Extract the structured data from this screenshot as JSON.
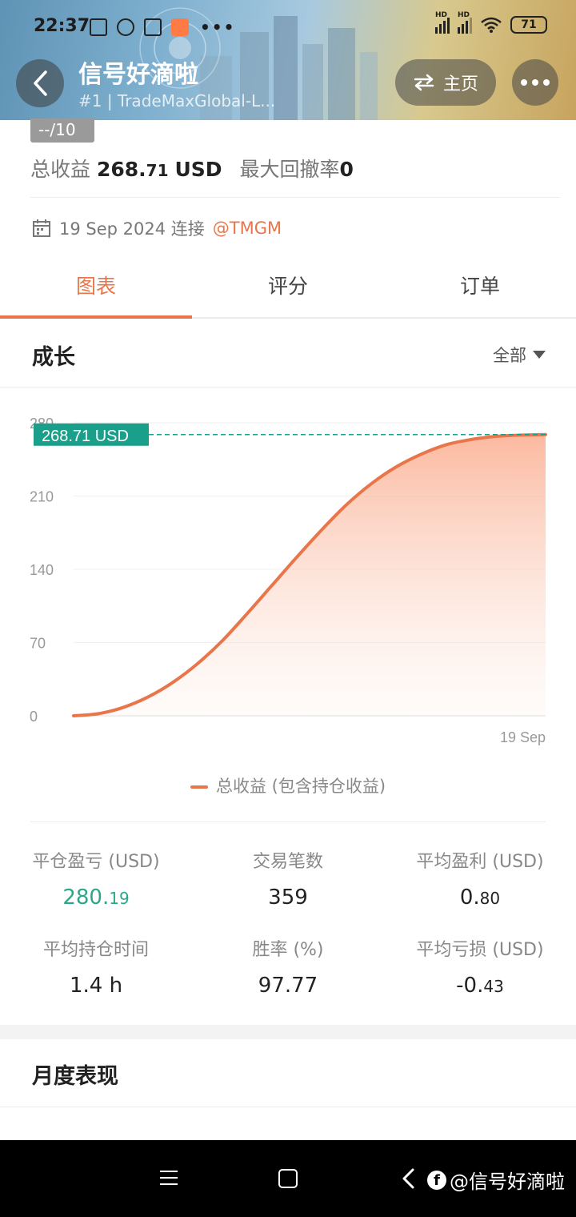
{
  "status_bar": {
    "time": "22:37",
    "battery": "71",
    "hd_label": "HD"
  },
  "header": {
    "title": "信号好滴啦",
    "subtitle": "#1 | TradeMaxGlobal-L...",
    "home_label": "主页"
  },
  "summary": {
    "score": "--/10",
    "total_profit_label": "总收益",
    "total_profit_int": "268.",
    "total_profit_frac": "71",
    "total_profit_unit": "USD",
    "max_drawdown_label": "最大回撤率",
    "max_drawdown_value": "0",
    "connected_date": "19 Sep 2024 连接",
    "broker": "@TMGM"
  },
  "tabs": [
    {
      "label": "图表",
      "active": true
    },
    {
      "label": "评分",
      "active": false
    },
    {
      "label": "订单",
      "active": false
    }
  ],
  "growth": {
    "title": "成长",
    "filter": "全部"
  },
  "chart_data": {
    "type": "area",
    "title": "",
    "ylim": [
      0,
      280
    ],
    "yticks": [
      0,
      70,
      140,
      210,
      280
    ],
    "x_label_end": "19 Sep",
    "current_label": "268.71 USD",
    "current_value": 268.71,
    "series": [
      {
        "name": "总收益 (包含持仓收益)",
        "values": [
          0,
          2,
          8,
          18,
          32,
          50,
          72,
          98,
          125,
          152,
          178,
          202,
          222,
          238,
          250,
          259,
          264,
          267,
          268.2,
          268.71
        ]
      }
    ],
    "colors": {
      "line": "#e8764a",
      "fill": "#fbb59a",
      "marker": "#1a9f8a"
    }
  },
  "legend": {
    "label": "总收益 (包含持仓收益)"
  },
  "stats": [
    {
      "label": "平仓盈亏 (USD)",
      "int": "280.",
      "frac": "19",
      "color": "green"
    },
    {
      "label": "交易笔数",
      "int": "359",
      "frac": "",
      "color": "default"
    },
    {
      "label": "平均盈利 (USD)",
      "int": "0.",
      "frac": "80",
      "color": "default"
    },
    {
      "label": "平均持仓时间",
      "int": "1.4 h",
      "frac": "",
      "color": "default"
    },
    {
      "label": "胜率 (%)",
      "int": "97.77",
      "frac": "",
      "color": "default"
    },
    {
      "label": "平均亏损 (USD)",
      "int": "-0.",
      "frac": "43",
      "color": "default"
    }
  ],
  "monthly": {
    "title": "月度表现"
  },
  "navbar": {
    "watermark": "@信号好滴啦",
    "logo_letter": "f"
  }
}
